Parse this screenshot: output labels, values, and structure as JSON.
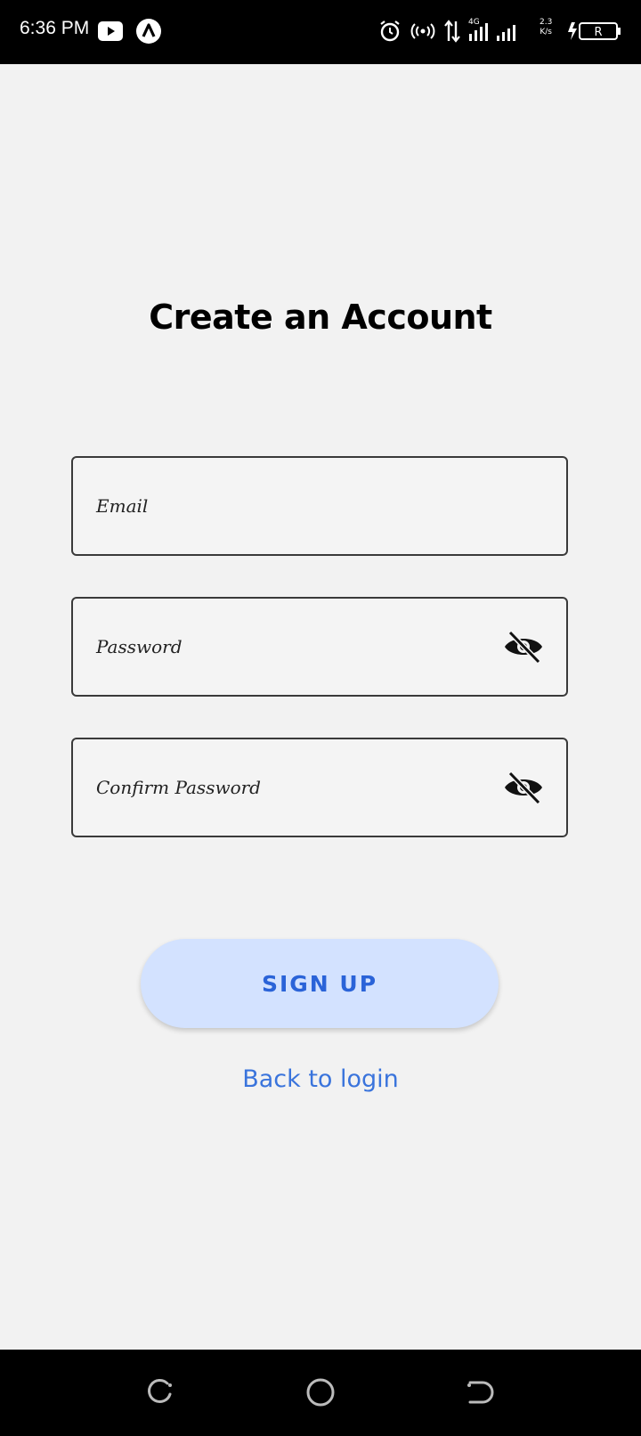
{
  "status_bar": {
    "time": "6:36 PM",
    "network_type": "4G",
    "speed_value": "2.3",
    "speed_unit": "K/s",
    "battery_label": "R",
    "icons": [
      "youtube-icon",
      "app-a-icon",
      "alarm-icon",
      "hotspot-icon",
      "data-transfer-icon",
      "signal-icon",
      "charging-icon",
      "battery-icon"
    ]
  },
  "form": {
    "title": "Create an Account",
    "email_placeholder": "Email",
    "password_placeholder": "Password",
    "confirm_placeholder": "Confirm Password",
    "signup_label": "SIGN UP",
    "back_label": "Back to login"
  },
  "colors": {
    "background": "#f2f2f2",
    "button_bg": "#d3e2ff",
    "button_text": "#2a63d8",
    "link": "#3a74dc"
  },
  "nav_bar": {
    "icons": [
      "recent-apps-icon",
      "home-icon",
      "back-icon"
    ]
  }
}
